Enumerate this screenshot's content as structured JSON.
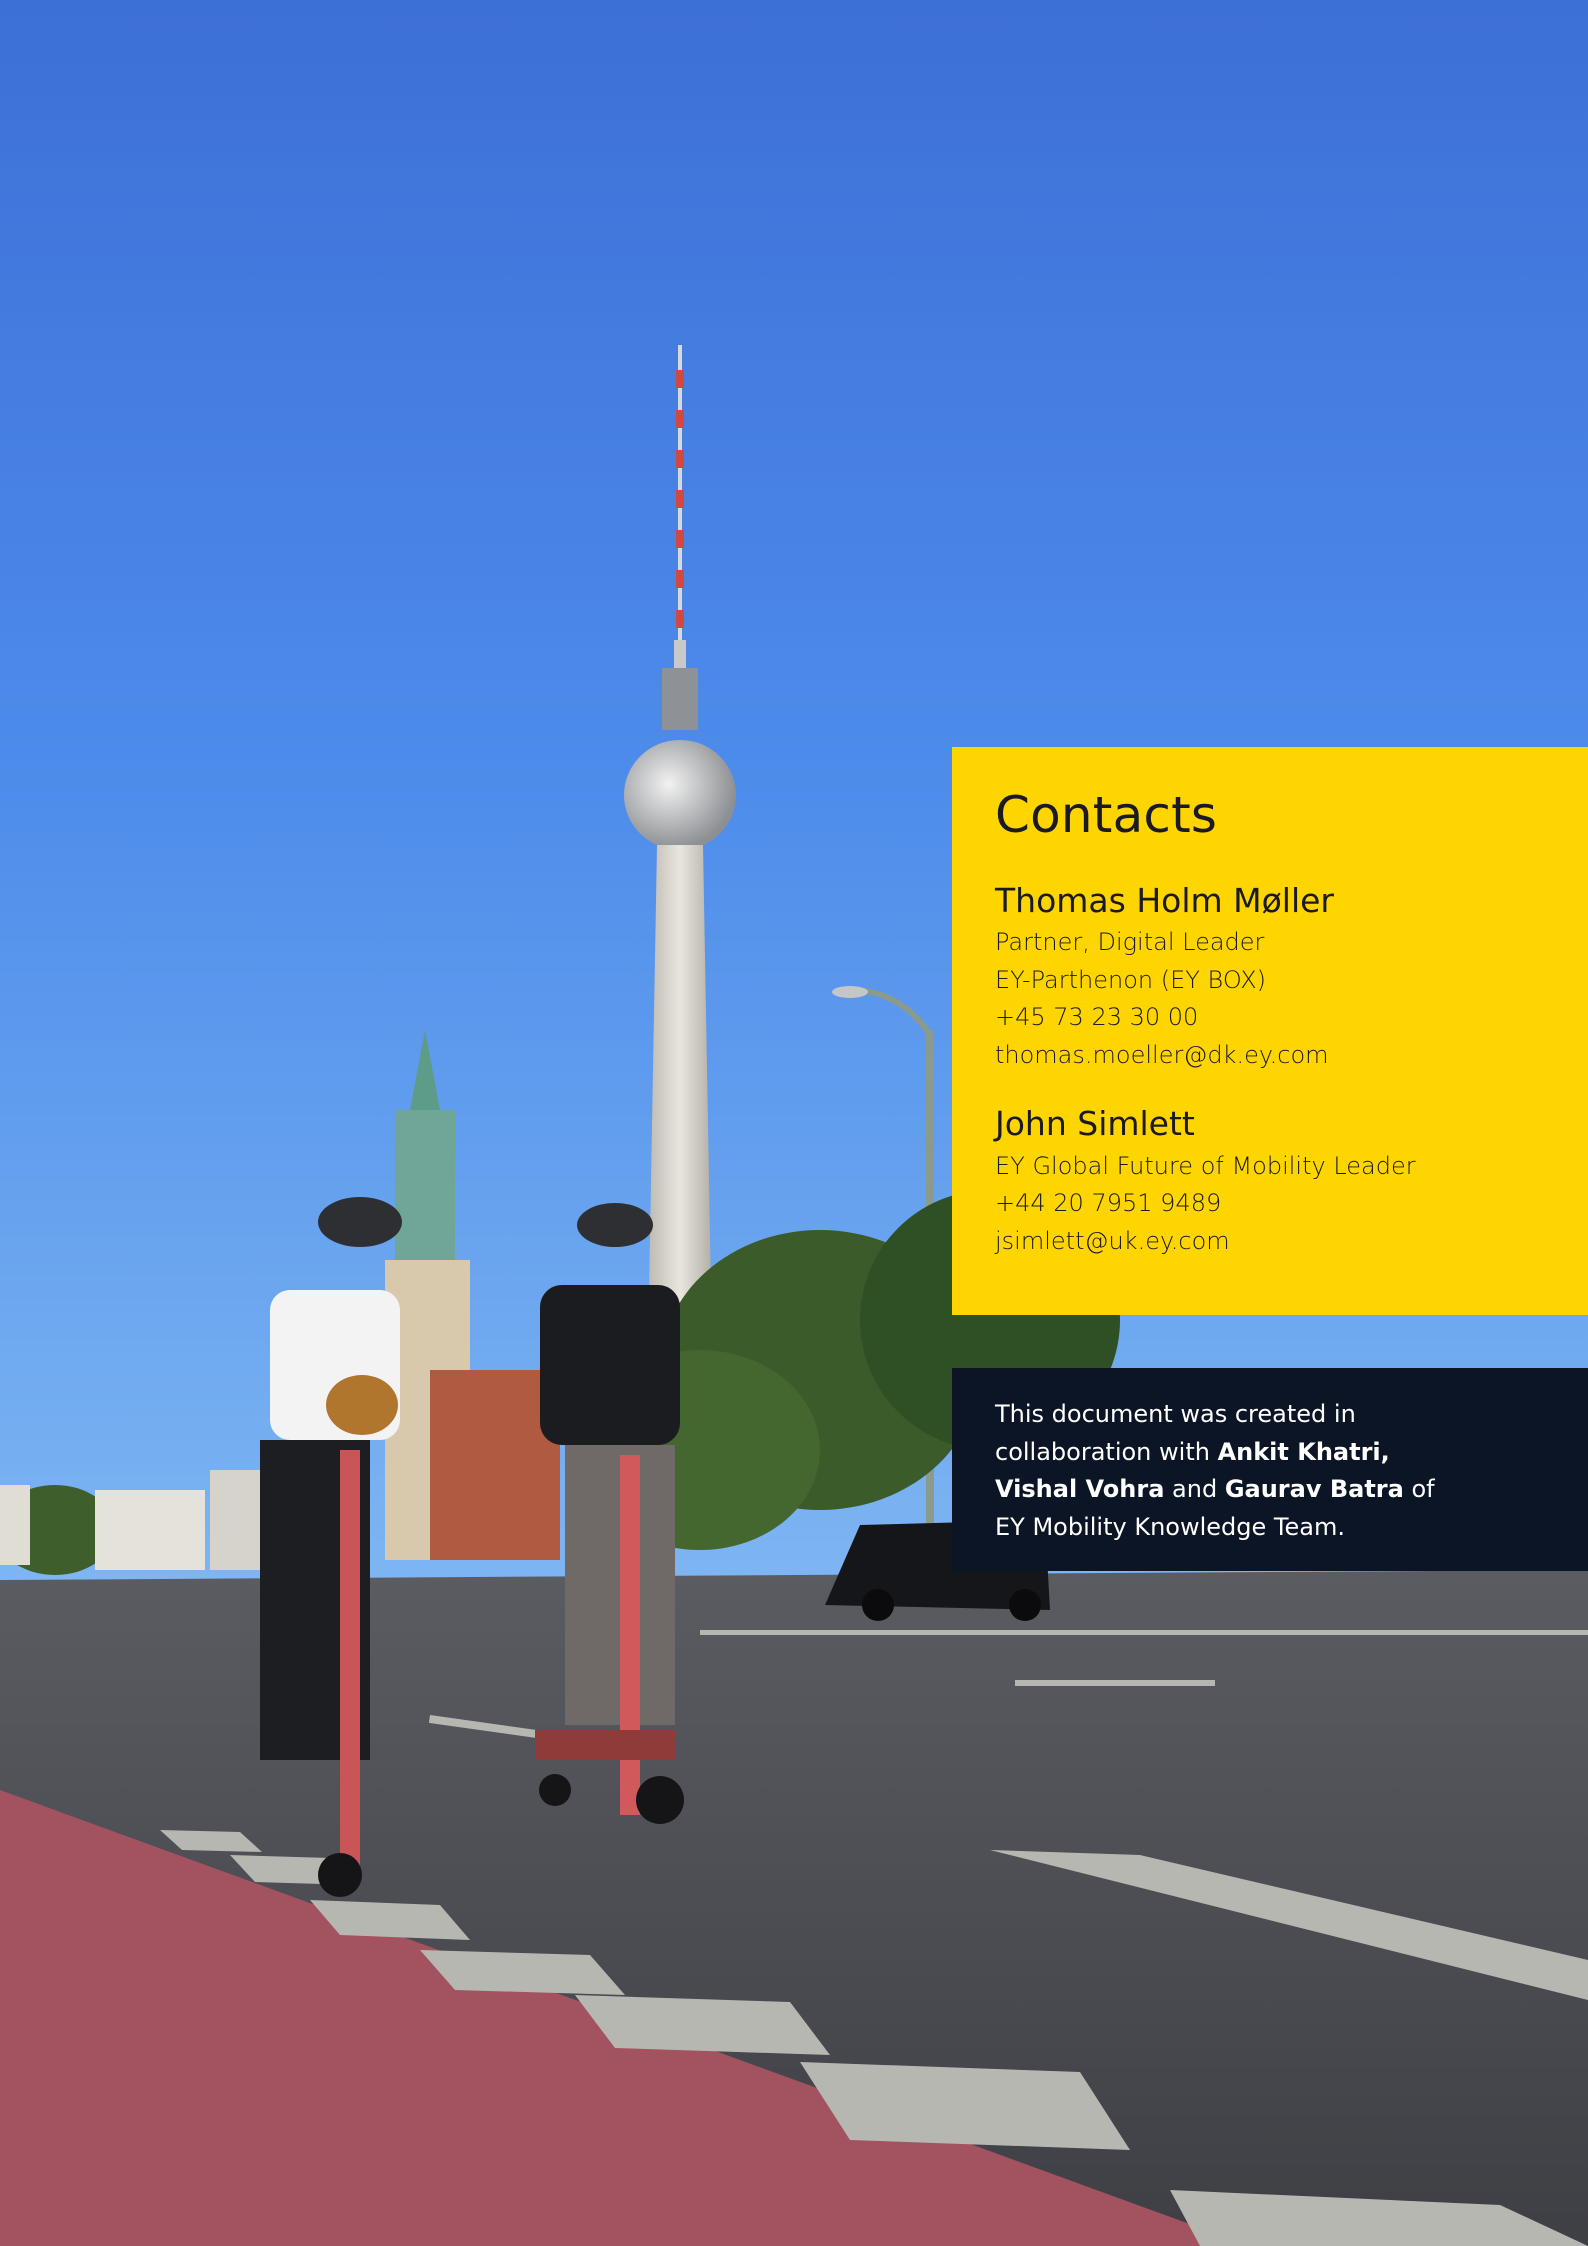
{
  "contacts": {
    "title": "Contacts",
    "people": [
      {
        "name": "Thomas Holm Møller",
        "lines": [
          "Partner, Digital Leader",
          "EY-Parthenon (EY BOX)",
          "+45 73 23 30 00",
          "thomas.moeller@dk.ey.com"
        ]
      },
      {
        "name": "John Simlett",
        "lines": [
          "EY Global Future of Mobility Leader",
          "+44 20 7951 9489",
          "jsimlett@uk.ey.com"
        ]
      }
    ]
  },
  "credit": {
    "line1": "This document was created in",
    "line2_prefix": "collaboration with ",
    "person1": "Ankit Khatri,",
    "person2": "Vishal Vohra",
    "and_word": " and ",
    "person3": "Gaurav Batra",
    "of_word": " of",
    "line4": "EY Mobility Knowledge Team."
  },
  "colors": {
    "brand_yellow": "#FFD500",
    "dark_navy": "#0C1526"
  }
}
